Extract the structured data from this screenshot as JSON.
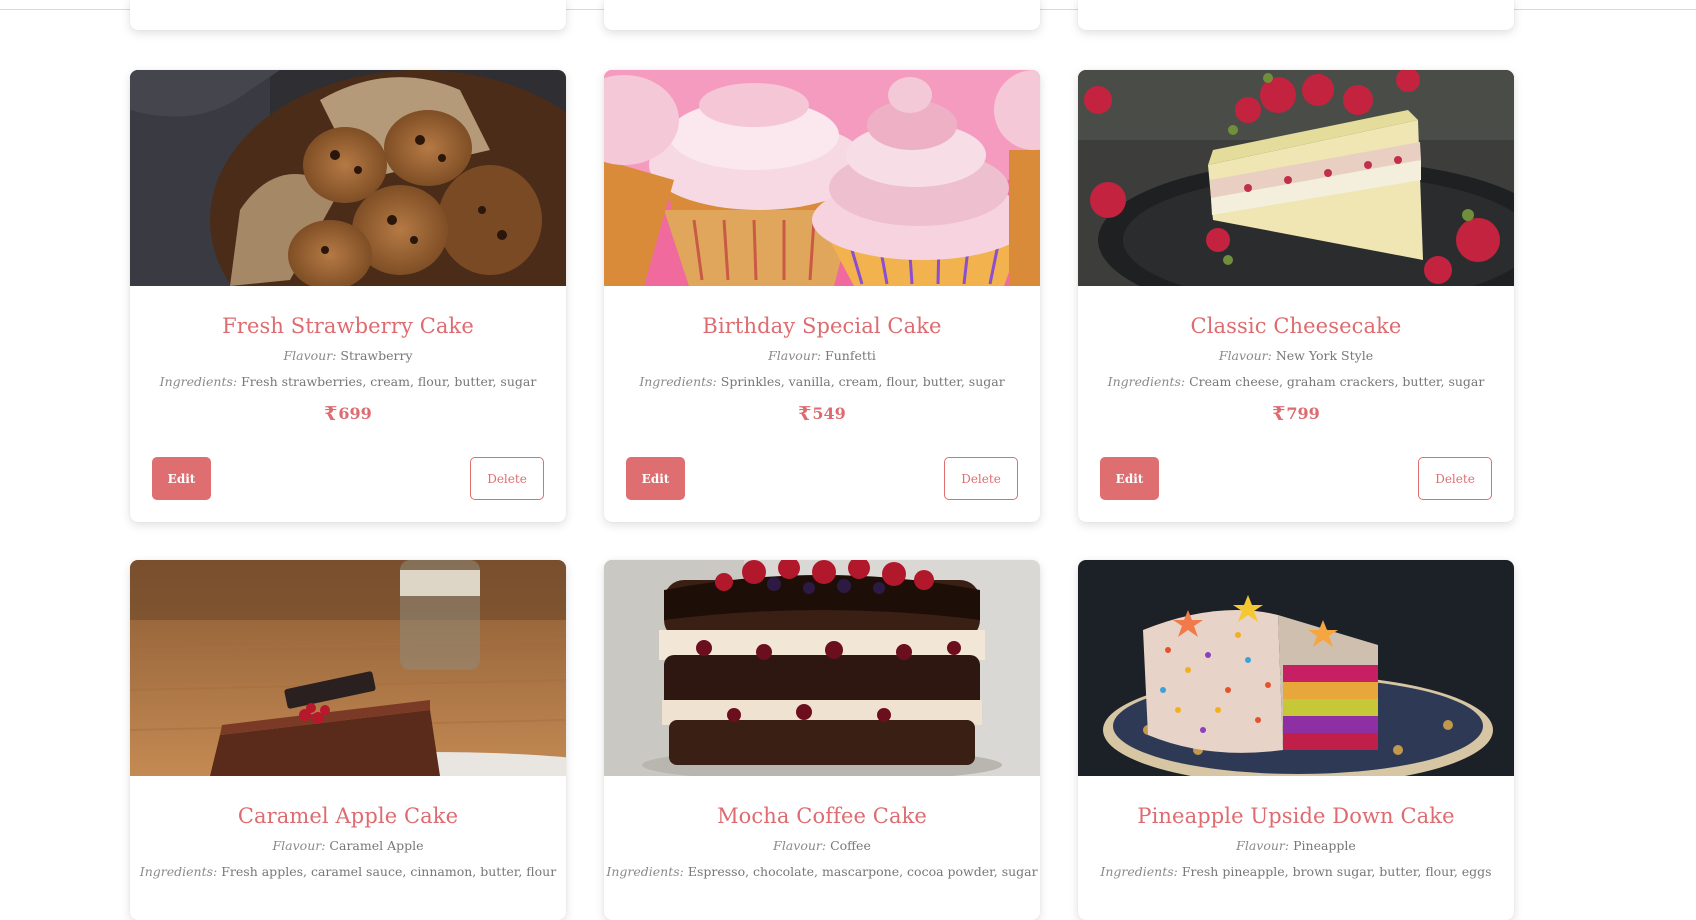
{
  "labels": {
    "flavour": "Flavour:",
    "ingredients": "Ingredients:",
    "currency": "₹",
    "edit": "Edit",
    "delete": "Delete"
  },
  "cakes": [
    {
      "name": "Fresh Strawberry Cake",
      "flavour": "Strawberry",
      "ingredients": "Fresh strawberries, cream, flour, butter, sugar",
      "price": "699",
      "image": "chocolate-chip-cookies-photo"
    },
    {
      "name": "Birthday Special Cake",
      "flavour": "Funfetti",
      "ingredients": "Sprinkles, vanilla, cream, flour, butter, sugar",
      "price": "549",
      "image": "frosted-cupcakes-photo"
    },
    {
      "name": "Classic Cheesecake",
      "flavour": "New York Style",
      "ingredients": "Cream cheese, graham crackers, butter, sugar",
      "price": "799",
      "image": "raspberry-layer-cake-slice-photo"
    },
    {
      "name": "Caramel Apple Cake",
      "flavour": "Caramel Apple",
      "ingredients": "Fresh apples, caramel sauce, cinnamon, butter, flour",
      "image": "tiramisu-slice-photo"
    },
    {
      "name": "Mocha Coffee Cake",
      "flavour": "Coffee",
      "ingredients": "Espresso, chocolate, mascarpone, cocoa powder, sugar",
      "image": "chocolate-berry-layer-cake-photo"
    },
    {
      "name": "Pineapple Upside Down Cake",
      "flavour": "Pineapple",
      "ingredients": "Fresh pineapple, brown sugar, butter, flour, eggs",
      "image": "rainbow-sprinkle-cake-photo"
    }
  ],
  "colors": {
    "accent": "#df6e71",
    "title": "#dd6b6f",
    "meta_text": "#777777"
  }
}
